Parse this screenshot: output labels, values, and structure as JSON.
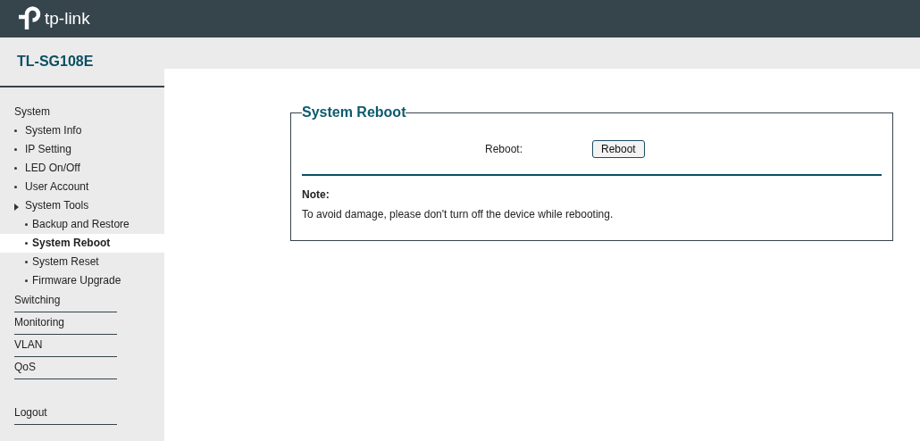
{
  "header": {
    "logo_text": "tp-link"
  },
  "model": "TL-SG108E",
  "menu": [
    {
      "label": "System",
      "kind": "heading",
      "children": [
        {
          "label": "System Info",
          "selected": false
        },
        {
          "label": "IP Setting",
          "selected": false
        },
        {
          "label": "LED On/Off",
          "selected": false
        },
        {
          "label": "User Account",
          "selected": false
        },
        {
          "label": "System Tools",
          "selected": false,
          "expanded": true,
          "children": [
            {
              "label": "Backup and Restore",
              "selected": false
            },
            {
              "label": "System Reboot",
              "selected": true
            },
            {
              "label": "System Reset",
              "selected": false
            },
            {
              "label": "Firmware Upgrade",
              "selected": false
            }
          ]
        }
      ]
    },
    {
      "label": "Switching",
      "kind": "section"
    },
    {
      "label": "Monitoring",
      "kind": "section"
    },
    {
      "label": "VLAN",
      "kind": "section"
    },
    {
      "label": "QoS",
      "kind": "section"
    }
  ],
  "logout": "Logout",
  "panel": {
    "title": "System Reboot",
    "field_label": "Reboot:",
    "button": "Reboot",
    "note_title": "Note:",
    "note_text": "To avoid damage, please don't turn off the device while rebooting."
  }
}
